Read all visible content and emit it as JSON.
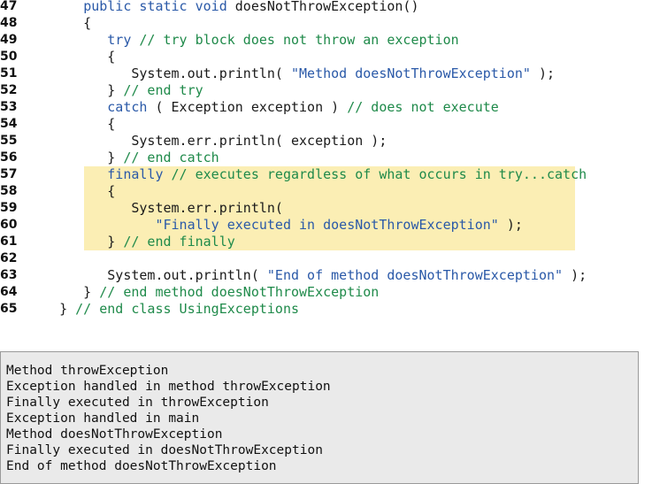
{
  "code_listing": {
    "lines": [
      {
        "number": "47",
        "code": "      public static void doesNotThrowException()"
      },
      {
        "number": "48",
        "code": "      {"
      },
      {
        "number": "49",
        "code": "         try // try block does not throw an exception"
      },
      {
        "number": "50",
        "code": "         {"
      },
      {
        "number": "51",
        "code": "            System.out.println( \"Method doesNotThrowException\" );"
      },
      {
        "number": "52",
        "code": "         } // end try"
      },
      {
        "number": "53",
        "code": "         catch ( Exception exception ) // does not execute"
      },
      {
        "number": "54",
        "code": "         {"
      },
      {
        "number": "55",
        "code": "            System.err.println( exception );"
      },
      {
        "number": "56",
        "code": "         } // end catch"
      },
      {
        "number": "57",
        "code": "         finally // executes regardless of what occurs in try...catch"
      },
      {
        "number": "58",
        "code": "         {"
      },
      {
        "number": "59",
        "code": "            System.err.println("
      },
      {
        "number": "60",
        "code": "               \"Finally executed in doesNotThrowException\" );"
      },
      {
        "number": "61",
        "code": "         } // end finally"
      },
      {
        "number": "62",
        "code": ""
      },
      {
        "number": "63",
        "code": "         System.out.println( \"End of method doesNotThrowException\" );"
      },
      {
        "number": "64",
        "code": "      } // end method doesNotThrowException"
      },
      {
        "number": "65",
        "code": "   } // end class UsingExceptions"
      }
    ]
  },
  "output_panel": {
    "lines": [
      "Method throwException",
      "Exception handled in method throwException",
      "Finally executed in throwException",
      "Exception handled in main",
      "Method doesNotThrowException",
      "Finally executed in doesNotThrowException",
      "End of method doesNotThrowException"
    ]
  },
  "colors": {
    "keyword": "#2a59a8",
    "comment": "#1f8a4a",
    "string": "#2a59a8",
    "highlight": "#fbeeb4",
    "output_background": "#eaeaea"
  }
}
